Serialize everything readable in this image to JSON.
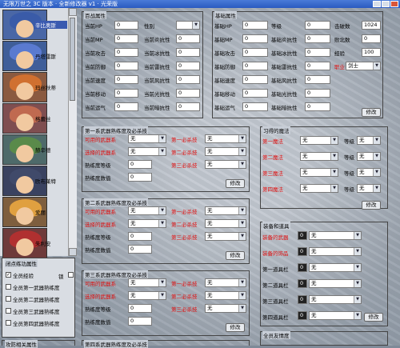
{
  "window": {
    "title": "无限万世之 3C 版本 · 全新修改器 v1 · 光荣版"
  },
  "characters": [
    {
      "name": "辛比奥斯",
      "hair": "#3a5ba8",
      "bg": "#4a67a6"
    },
    {
      "name": "丹塔雷斯",
      "hair": "#5a7ad0",
      "bg": "#3f5e99"
    },
    {
      "name": "玛丝秋蒂",
      "hair": "#d07030",
      "bg": "#8a5a40"
    },
    {
      "name": "格蕾丝",
      "hair": "#c06a50",
      "bg": "#7f4e50"
    },
    {
      "name": "赫辛德",
      "hair": "#5a8a4a",
      "bg": "#4e6a6a"
    },
    {
      "name": "欧布莱特",
      "hair": "#404a6a",
      "bg": "#3a4260"
    },
    {
      "name": "爱丽",
      "hair": "#e0a040",
      "bg": "#7e5e3e"
    },
    {
      "name": "朱利安",
      "hair": "#b03030",
      "bg": "#6e3a3a"
    }
  ],
  "props": {
    "title": "百战属性",
    "rows": [
      {
        "l1": "当前HP",
        "v1": "0",
        "l2": "性别",
        "v2": ""
      },
      {
        "l1": "当前MP",
        "v1": "0",
        "l2": "当前炎抗性",
        "v2": "0"
      },
      {
        "l1": "当前攻击",
        "v1": "0",
        "l2": "当前冰抗性",
        "v2": "0"
      },
      {
        "l1": "当前防御",
        "v1": "0",
        "l2": "当前雷抗性",
        "v2": "0"
      },
      {
        "l1": "当前速度",
        "v1": "0",
        "l2": "当前风抗性",
        "v2": "0"
      },
      {
        "l1": "当前移动",
        "v1": "0",
        "l2": "当前光抗性",
        "v2": "0"
      },
      {
        "l1": "当前运气",
        "v1": "0",
        "l2": "当前暗抗性",
        "v2": "0"
      }
    ]
  },
  "base": {
    "title": "基础属性",
    "rows": [
      {
        "l1": "基础HP",
        "v1": "0",
        "l2": "等级",
        "v2": "0",
        "l3": "击破数",
        "v3": "1024"
      },
      {
        "l1": "基础MP",
        "v1": "0",
        "l2": "基础炎抗性",
        "v2": "0",
        "l3": "败北数",
        "v3": "0"
      },
      {
        "l1": "基础攻击",
        "v1": "0",
        "l2": "基础冰抗性",
        "v2": "0",
        "l3": "经验",
        "v3": "100"
      },
      {
        "l1": "基础防御",
        "v1": "0",
        "l2": "基础雷抗性",
        "v2": "0",
        "l3": "职业",
        "v3": "剑士"
      },
      {
        "l1": "基础速度",
        "v1": "0",
        "l2": "基础风抗性",
        "v2": "0"
      },
      {
        "l1": "基础移动",
        "v1": "0",
        "l2": "基础光抗性",
        "v2": "0"
      },
      {
        "l1": "基础运气",
        "v1": "0",
        "l2": "基础暗抗性",
        "v2": "0"
      }
    ],
    "modify": "修改"
  },
  "weapon1": {
    "title": "第一系武器熟练度及必杀技",
    "usable": "可用的武器系",
    "usable_val": "无",
    "select": "选择的武器系",
    "select_val": "无",
    "skill": "熟练度等级",
    "skill_val": "0",
    "num": "熟练度数值",
    "num_val": "0",
    "k1": "第一必杀技",
    "k1v": "无",
    "k2": "第二必杀技",
    "k2v": "无",
    "k3": "第三必杀技",
    "k3v": "无",
    "modify": "修改"
  },
  "weapon2": {
    "title": "第二系武器熟练度及必杀技",
    "usable": "可用的武器系",
    "usable_val": "无",
    "select": "选择的武器系",
    "select_val": "无",
    "skill": "熟练度等级",
    "skill_val": "0",
    "num": "熟练度数值",
    "num_val": "0",
    "k1": "第一必杀技",
    "k1v": "无",
    "k2": "第二必杀技",
    "k2v": "无",
    "k3": "第三必杀技",
    "k3v": "无",
    "modify": "修改"
  },
  "weapon3": {
    "title": "第三系武器熟练度及必杀技",
    "usable": "可用的武器系",
    "usable_val": "无",
    "select": "选择的武器系",
    "select_val": "无",
    "skill": "熟练度等级",
    "skill_val": "0",
    "num": "熟练度数值",
    "num_val": "0",
    "k1": "第一必杀技",
    "k1v": "无",
    "k2": "第二必杀技",
    "k2v": "无",
    "k3": "第三必杀技",
    "k3v": "无",
    "modify": "修改"
  },
  "weapon4": {
    "title": "第四系武器熟练度及必杀技"
  },
  "magic": {
    "title": "习得的魔法",
    "rows": [
      {
        "l": "第一魔法",
        "v": "无",
        "lv": "等级",
        "lvv": "无"
      },
      {
        "l": "第二魔法",
        "v": "无",
        "lv": "等级",
        "lvv": "无"
      },
      {
        "l": "第三魔法",
        "v": "无",
        "lv": "等级",
        "lvv": "无"
      },
      {
        "l": "第四魔法",
        "v": "无",
        "lv": "等级",
        "lvv": "无"
      }
    ],
    "modify": "修改"
  },
  "equip": {
    "title": "装备和道具",
    "rows": [
      {
        "l": "装备的武器",
        "n": "0",
        "v": "无"
      },
      {
        "l": "装备的饰品",
        "n": "0",
        "v": "无"
      },
      {
        "l": "第一道具栏",
        "n": "0",
        "v": "无"
      },
      {
        "l": "第二道具栏",
        "n": "0",
        "v": "无"
      },
      {
        "l": "第三道具栏",
        "n": "0",
        "v": "无"
      },
      {
        "l": "第四道具栏",
        "n": "0",
        "v": "无"
      }
    ],
    "modify": "修改"
  },
  "points": {
    "title": "闭点练功属性",
    "items": [
      {
        "label": "全员经验",
        "checked": true
      },
      {
        "label": "全员第一武器熟练度",
        "checked": false
      },
      {
        "label": "全员第二武器熟练度",
        "checked": false
      },
      {
        "label": "全员第三武器熟练度",
        "checked": false
      },
      {
        "label": "全员第四武器熟练度",
        "checked": false
      }
    ],
    "lock": "锁"
  },
  "bottom": {
    "left_title": "攻防相关属性",
    "right_title": "全员友情度"
  }
}
